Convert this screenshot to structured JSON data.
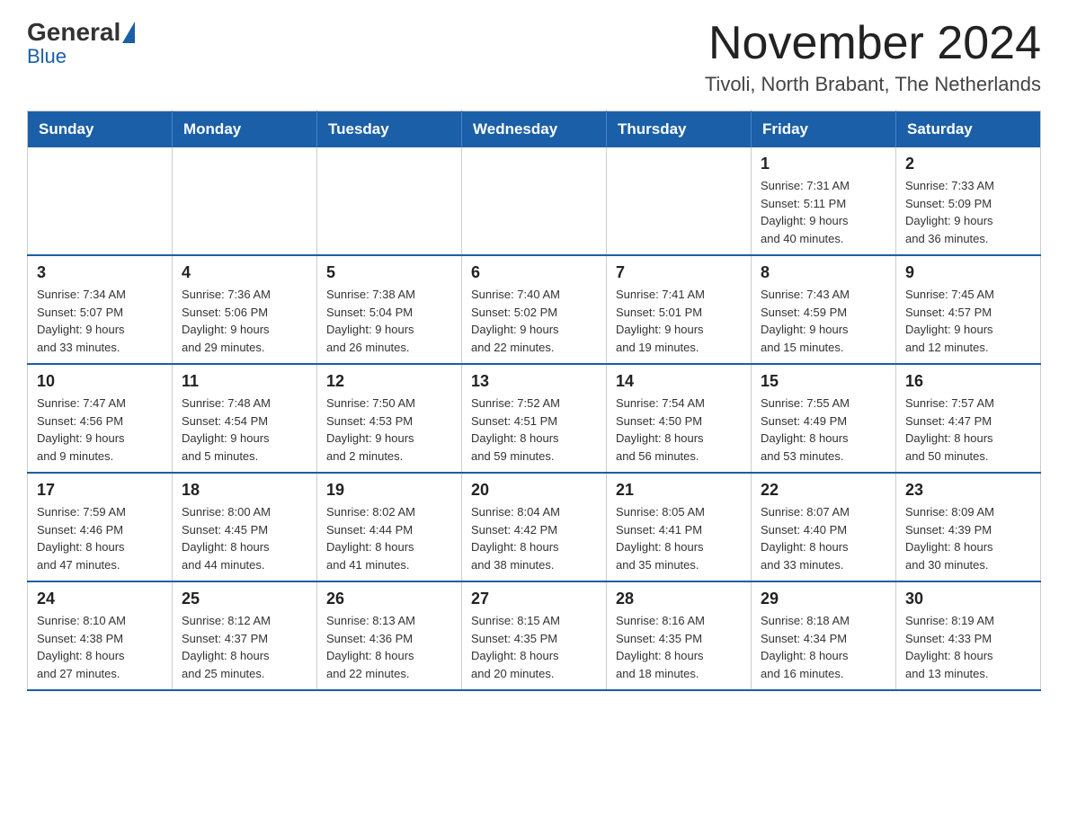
{
  "logo": {
    "general_text": "General",
    "blue_text": "Blue"
  },
  "header": {
    "month_title": "November 2024",
    "location": "Tivoli, North Brabant, The Netherlands"
  },
  "weekdays": [
    "Sunday",
    "Monday",
    "Tuesday",
    "Wednesday",
    "Thursday",
    "Friday",
    "Saturday"
  ],
  "weeks": [
    [
      {
        "day": "",
        "info": ""
      },
      {
        "day": "",
        "info": ""
      },
      {
        "day": "",
        "info": ""
      },
      {
        "day": "",
        "info": ""
      },
      {
        "day": "",
        "info": ""
      },
      {
        "day": "1",
        "info": "Sunrise: 7:31 AM\nSunset: 5:11 PM\nDaylight: 9 hours\nand 40 minutes."
      },
      {
        "day": "2",
        "info": "Sunrise: 7:33 AM\nSunset: 5:09 PM\nDaylight: 9 hours\nand 36 minutes."
      }
    ],
    [
      {
        "day": "3",
        "info": "Sunrise: 7:34 AM\nSunset: 5:07 PM\nDaylight: 9 hours\nand 33 minutes."
      },
      {
        "day": "4",
        "info": "Sunrise: 7:36 AM\nSunset: 5:06 PM\nDaylight: 9 hours\nand 29 minutes."
      },
      {
        "day": "5",
        "info": "Sunrise: 7:38 AM\nSunset: 5:04 PM\nDaylight: 9 hours\nand 26 minutes."
      },
      {
        "day": "6",
        "info": "Sunrise: 7:40 AM\nSunset: 5:02 PM\nDaylight: 9 hours\nand 22 minutes."
      },
      {
        "day": "7",
        "info": "Sunrise: 7:41 AM\nSunset: 5:01 PM\nDaylight: 9 hours\nand 19 minutes."
      },
      {
        "day": "8",
        "info": "Sunrise: 7:43 AM\nSunset: 4:59 PM\nDaylight: 9 hours\nand 15 minutes."
      },
      {
        "day": "9",
        "info": "Sunrise: 7:45 AM\nSunset: 4:57 PM\nDaylight: 9 hours\nand 12 minutes."
      }
    ],
    [
      {
        "day": "10",
        "info": "Sunrise: 7:47 AM\nSunset: 4:56 PM\nDaylight: 9 hours\nand 9 minutes."
      },
      {
        "day": "11",
        "info": "Sunrise: 7:48 AM\nSunset: 4:54 PM\nDaylight: 9 hours\nand 5 minutes."
      },
      {
        "day": "12",
        "info": "Sunrise: 7:50 AM\nSunset: 4:53 PM\nDaylight: 9 hours\nand 2 minutes."
      },
      {
        "day": "13",
        "info": "Sunrise: 7:52 AM\nSunset: 4:51 PM\nDaylight: 8 hours\nand 59 minutes."
      },
      {
        "day": "14",
        "info": "Sunrise: 7:54 AM\nSunset: 4:50 PM\nDaylight: 8 hours\nand 56 minutes."
      },
      {
        "day": "15",
        "info": "Sunrise: 7:55 AM\nSunset: 4:49 PM\nDaylight: 8 hours\nand 53 minutes."
      },
      {
        "day": "16",
        "info": "Sunrise: 7:57 AM\nSunset: 4:47 PM\nDaylight: 8 hours\nand 50 minutes."
      }
    ],
    [
      {
        "day": "17",
        "info": "Sunrise: 7:59 AM\nSunset: 4:46 PM\nDaylight: 8 hours\nand 47 minutes."
      },
      {
        "day": "18",
        "info": "Sunrise: 8:00 AM\nSunset: 4:45 PM\nDaylight: 8 hours\nand 44 minutes."
      },
      {
        "day": "19",
        "info": "Sunrise: 8:02 AM\nSunset: 4:44 PM\nDaylight: 8 hours\nand 41 minutes."
      },
      {
        "day": "20",
        "info": "Sunrise: 8:04 AM\nSunset: 4:42 PM\nDaylight: 8 hours\nand 38 minutes."
      },
      {
        "day": "21",
        "info": "Sunrise: 8:05 AM\nSunset: 4:41 PM\nDaylight: 8 hours\nand 35 minutes."
      },
      {
        "day": "22",
        "info": "Sunrise: 8:07 AM\nSunset: 4:40 PM\nDaylight: 8 hours\nand 33 minutes."
      },
      {
        "day": "23",
        "info": "Sunrise: 8:09 AM\nSunset: 4:39 PM\nDaylight: 8 hours\nand 30 minutes."
      }
    ],
    [
      {
        "day": "24",
        "info": "Sunrise: 8:10 AM\nSunset: 4:38 PM\nDaylight: 8 hours\nand 27 minutes."
      },
      {
        "day": "25",
        "info": "Sunrise: 8:12 AM\nSunset: 4:37 PM\nDaylight: 8 hours\nand 25 minutes."
      },
      {
        "day": "26",
        "info": "Sunrise: 8:13 AM\nSunset: 4:36 PM\nDaylight: 8 hours\nand 22 minutes."
      },
      {
        "day": "27",
        "info": "Sunrise: 8:15 AM\nSunset: 4:35 PM\nDaylight: 8 hours\nand 20 minutes."
      },
      {
        "day": "28",
        "info": "Sunrise: 8:16 AM\nSunset: 4:35 PM\nDaylight: 8 hours\nand 18 minutes."
      },
      {
        "day": "29",
        "info": "Sunrise: 8:18 AM\nSunset: 4:34 PM\nDaylight: 8 hours\nand 16 minutes."
      },
      {
        "day": "30",
        "info": "Sunrise: 8:19 AM\nSunset: 4:33 PM\nDaylight: 8 hours\nand 13 minutes."
      }
    ]
  ]
}
